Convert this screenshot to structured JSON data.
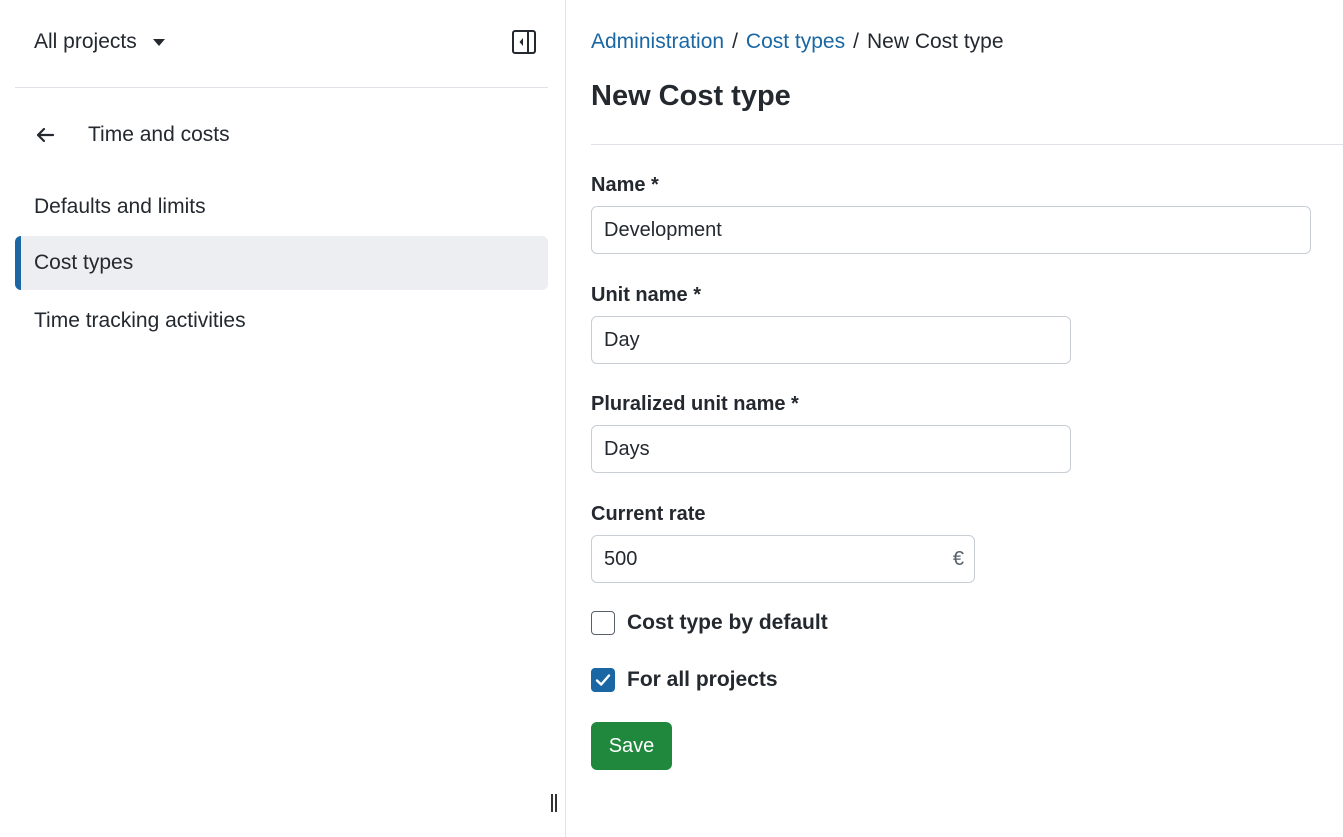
{
  "sidebar": {
    "project_selector": "All projects",
    "back_label": "Time and costs",
    "items": [
      {
        "label": "Defaults and limits",
        "active": false
      },
      {
        "label": "Cost types",
        "active": true
      },
      {
        "label": "Time tracking activities",
        "active": false
      }
    ]
  },
  "breadcrumb": {
    "items": [
      "Administration",
      "Cost types"
    ],
    "separator": "/",
    "current": "New Cost type"
  },
  "page": {
    "title": "New Cost type"
  },
  "form": {
    "name": {
      "label": "Name *",
      "value": "Development"
    },
    "unit_name": {
      "label": "Unit name *",
      "value": "Day"
    },
    "plural_unit_name": {
      "label": "Pluralized unit name *",
      "value": "Days"
    },
    "current_rate": {
      "label": "Current rate",
      "value": "500",
      "unit": "€"
    },
    "default_checkbox": {
      "label": "Cost type by default",
      "checked": false
    },
    "all_projects_checkbox": {
      "label": "For all projects",
      "checked": true
    },
    "save_label": "Save"
  },
  "colors": {
    "accent": "#1a67a3",
    "save_button": "#1f883d",
    "active_item_bg": "#eceef1"
  },
  "icons": {
    "project_caret": "caret-down-icon",
    "collapse": "sidebar-collapse-icon",
    "back": "arrow-left-icon",
    "checkmark": "check-icon",
    "resize": "resize-handle-icon"
  }
}
